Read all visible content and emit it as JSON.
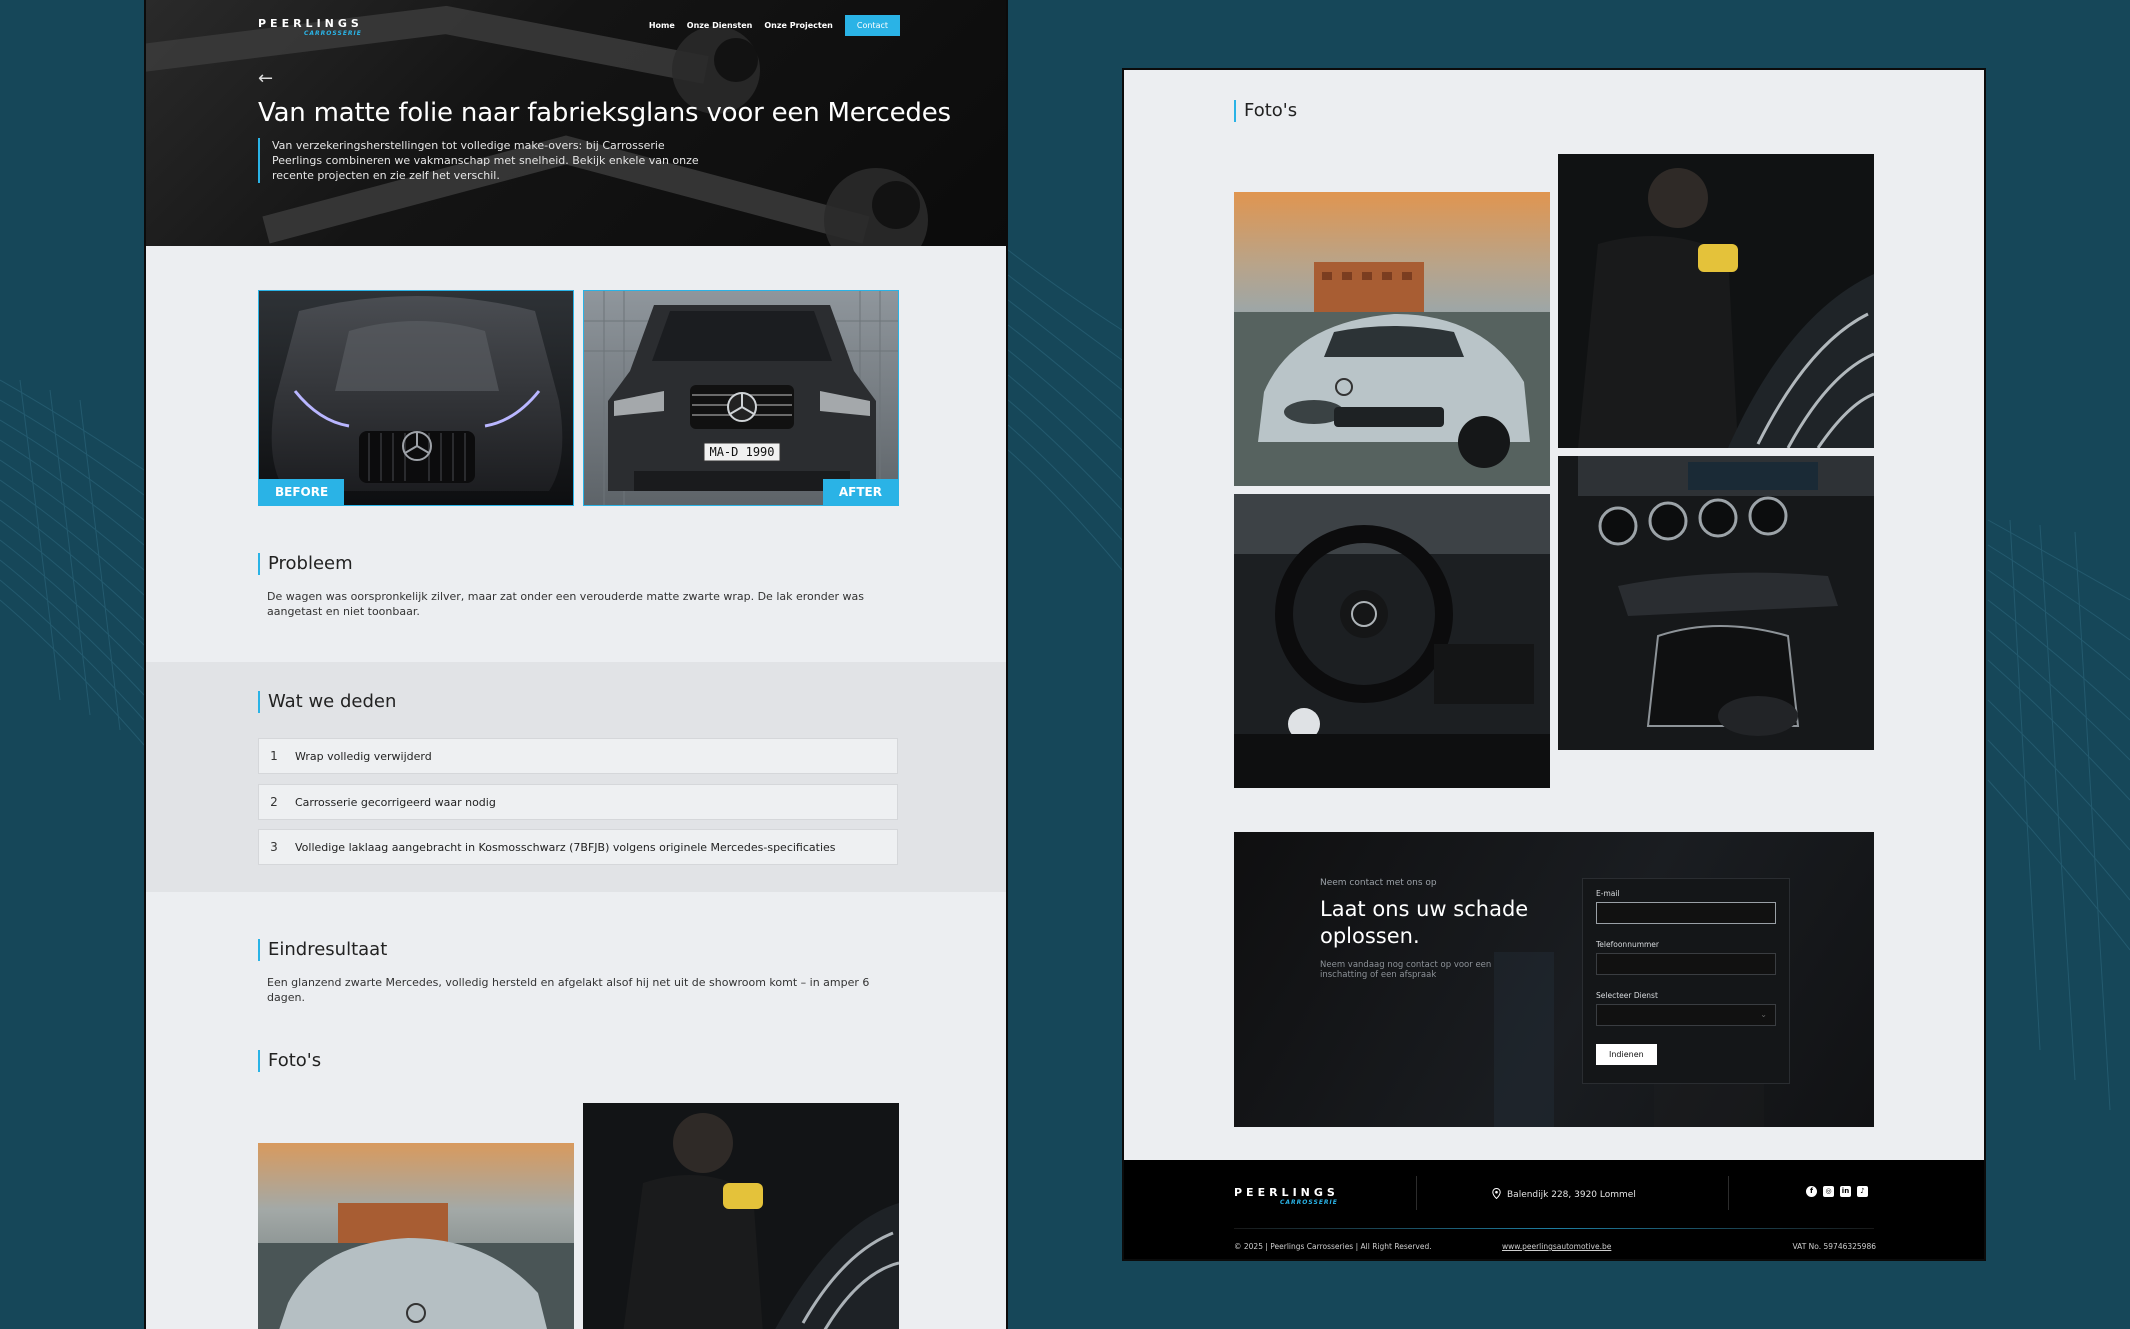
{
  "brand": {
    "name": "PEERLINGS",
    "sub": "CARROSSERIE"
  },
  "nav": {
    "items": [
      "Home",
      "Onze Diensten",
      "Onze Projecten"
    ],
    "contact": "Contact"
  },
  "hero": {
    "back_icon": "arrow-left-icon",
    "title": "Van matte folie naar fabrieksglans voor een Mercedes",
    "description": "Van verzekeringsherstellingen tot volledige make-overs: bij Carrosserie Peerlings combineren we vakmanschap met snelheid. Bekijk enkele van onze recente projecten en zie zelf het verschil."
  },
  "before_after": {
    "before": "BEFORE",
    "after": "AFTER",
    "plate": "MA-D 1990"
  },
  "problem": {
    "heading": "Probleem",
    "text": "De wagen was oorspronkelijk zilver, maar zat onder een verouderde matte zwarte wrap. De lak eronder was aangetast en niet toonbaar."
  },
  "what_we_did": {
    "heading": "Wat we deden",
    "steps": [
      {
        "num": "1",
        "text": "Wrap volledig verwijderd"
      },
      {
        "num": "2",
        "text": "Carrosserie gecorrigeerd waar nodig"
      },
      {
        "num": "3",
        "text": "Volledige laklaag aangebracht in Kosmosschwarz (7BFJB) volgens originele Mercedes-specificaties"
      }
    ]
  },
  "result": {
    "heading": "Eindresultaat",
    "text": "Een glanzend zwarte Mercedes, volledig hersteld en afgelakt alsof hij net uit de showroom komt – in amper 6 dagen."
  },
  "photos": {
    "heading": "Foto's"
  },
  "contact": {
    "eyebrow": "Neem contact met ons op",
    "title": "Laat ons uw schade oplossen.",
    "description": "Neem vandaag nog contact op voor een inschatting of een afspraak",
    "form": {
      "email_label": "E-mail",
      "phone_label": "Telefoonnummer",
      "service_label": "Selecteer Dienst",
      "submit": "Indienen"
    }
  },
  "footer": {
    "address": "Balendijk 228, 3920 Lommel",
    "copyright": "© 2025 | Peerlings Carrosseries | All Right Reserved.",
    "url": "www.peerlingsautomotive.be",
    "vat": "VAT No. 59746325986",
    "socials": [
      "facebook-icon",
      "instagram-icon",
      "linkedin-icon",
      "tiktok-icon"
    ]
  },
  "colors": {
    "accent": "#2ab3e6",
    "background": "#164759",
    "page": "#eceef1",
    "dark": "#0b0b0b"
  }
}
